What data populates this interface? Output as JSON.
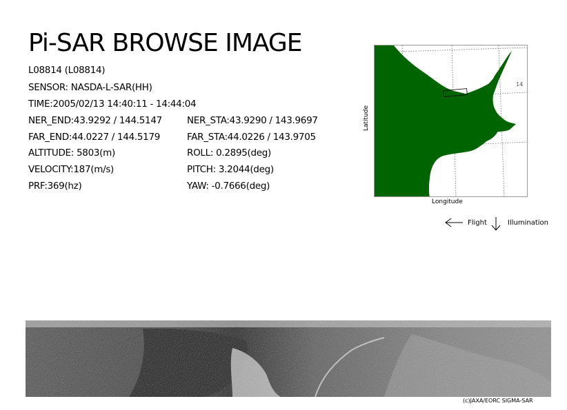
{
  "title": "Pi-SAR BROWSE IMAGE",
  "info": {
    "scene_id": "L08814 (L08814)",
    "sensor": "SENSOR: NASDA-L-SAR(HH)",
    "time": "TIME:2005/02/13  14:40:11 - 14:44:04",
    "ner_end": "NER_END:43.9292 / 144.5147",
    "ner_sta": "NER_STA:43.9290 / 143.9697",
    "far_end": "FAR_END:44.0227 / 144.5179",
    "far_sta": "FAR_STA:44.0226 / 143.9705",
    "altitude": "ALTITUDE: 5803(m)",
    "roll": "ROLL: 0.2895(deg)",
    "velocity": "VELOCITY:187(m/s)",
    "pitch": "PITCH:  3.2044(deg)",
    "prf": "PRF:369(hz)",
    "yaw": "YAW:  -0.7666(deg)"
  },
  "map": {
    "ylabel": "Latitude",
    "xlabel": "Longitude",
    "grid_label": "14",
    "land_color": "#006400"
  },
  "legend": {
    "flight": "Flight",
    "illumination": "Illumination"
  },
  "credit": "(c)JAXA/EORC SIGMA-SAR"
}
